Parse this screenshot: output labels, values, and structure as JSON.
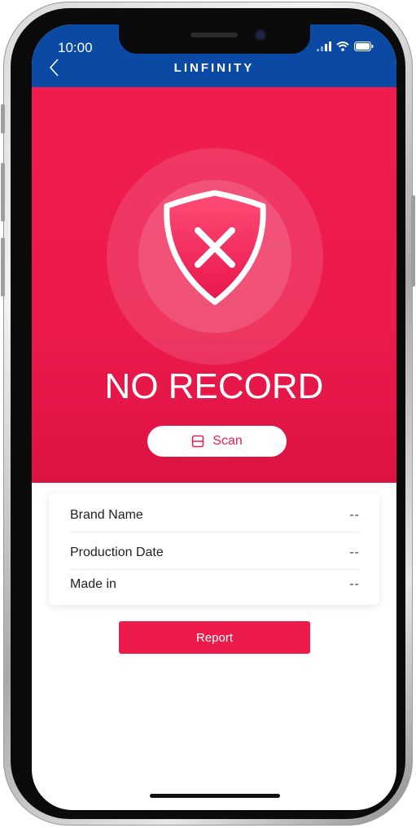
{
  "status_bar": {
    "time": "10:00"
  },
  "header": {
    "title": "LINFINITY",
    "back_icon": "chevron-left-icon"
  },
  "result": {
    "icon": "shield-x-icon",
    "status_text": "NO RECORD",
    "scan_label": "Scan",
    "scan_icon": "scan-icon"
  },
  "product_info": {
    "rows": [
      {
        "label": "Brand Name",
        "value": "--"
      },
      {
        "label": "Production Date",
        "value": "--"
      },
      {
        "label": "Made in",
        "value": "--"
      }
    ]
  },
  "actions": {
    "report_label": "Report"
  },
  "colors": {
    "header_blue": "#0a4aa4",
    "accent_red": "#ec1b4c"
  }
}
